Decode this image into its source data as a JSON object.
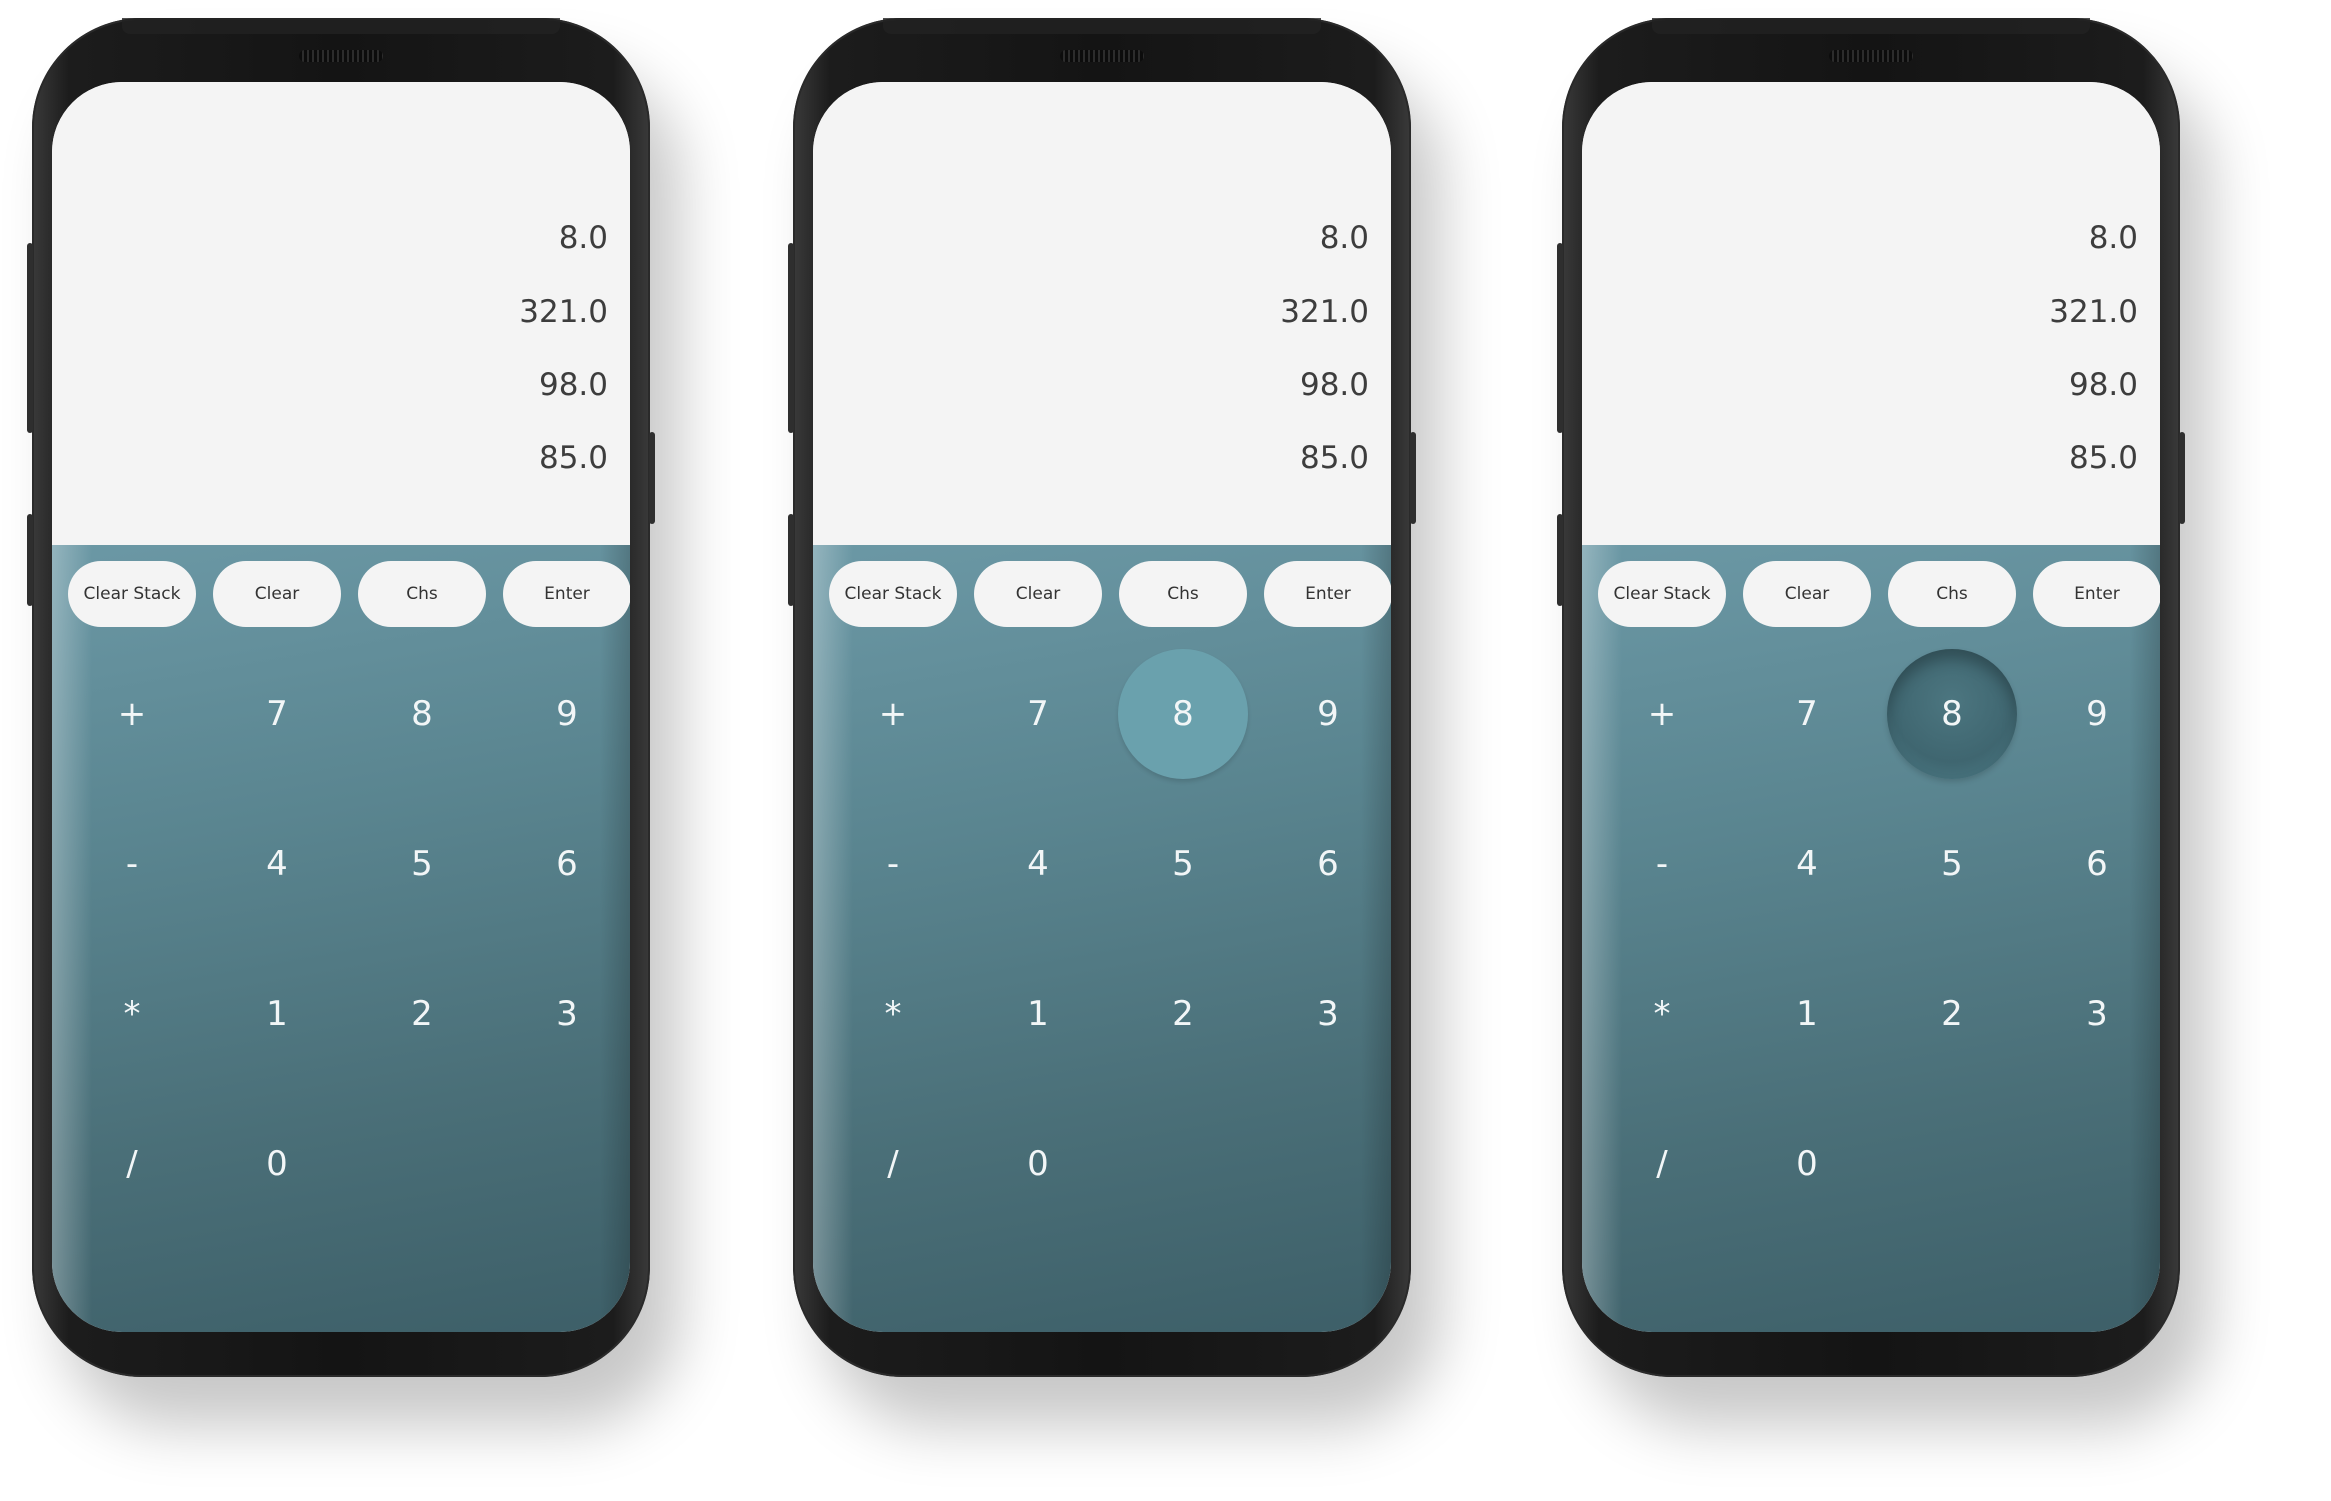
{
  "stack": [
    "8.0",
    "321.0",
    "98.0",
    "85.0"
  ],
  "functions": {
    "clear_stack": "Clear Stack",
    "clear": "Clear",
    "chs": "Chs",
    "enter": "Enter"
  },
  "keys": {
    "plus": "+",
    "seven": "7",
    "eight": "8",
    "nine": "9",
    "minus": "-",
    "four": "4",
    "five": "5",
    "six": "6",
    "multiply": "*",
    "one": "1",
    "two": "2",
    "three": "3",
    "divide": "/",
    "zero": "0"
  },
  "phones": [
    {
      "state": "normal"
    },
    {
      "state": "hover",
      "highlighted_key": "8"
    },
    {
      "state": "pressed",
      "highlighted_key": "8"
    }
  ],
  "colors": {
    "display_bg": "#f4f4f4",
    "keypad_top": "#6b98a5",
    "keypad_bottom": "#3d5f68",
    "pill_bg": "#f4f4f4",
    "hover_key": "#6aa1ad",
    "pressed_key": "#3f6670"
  }
}
